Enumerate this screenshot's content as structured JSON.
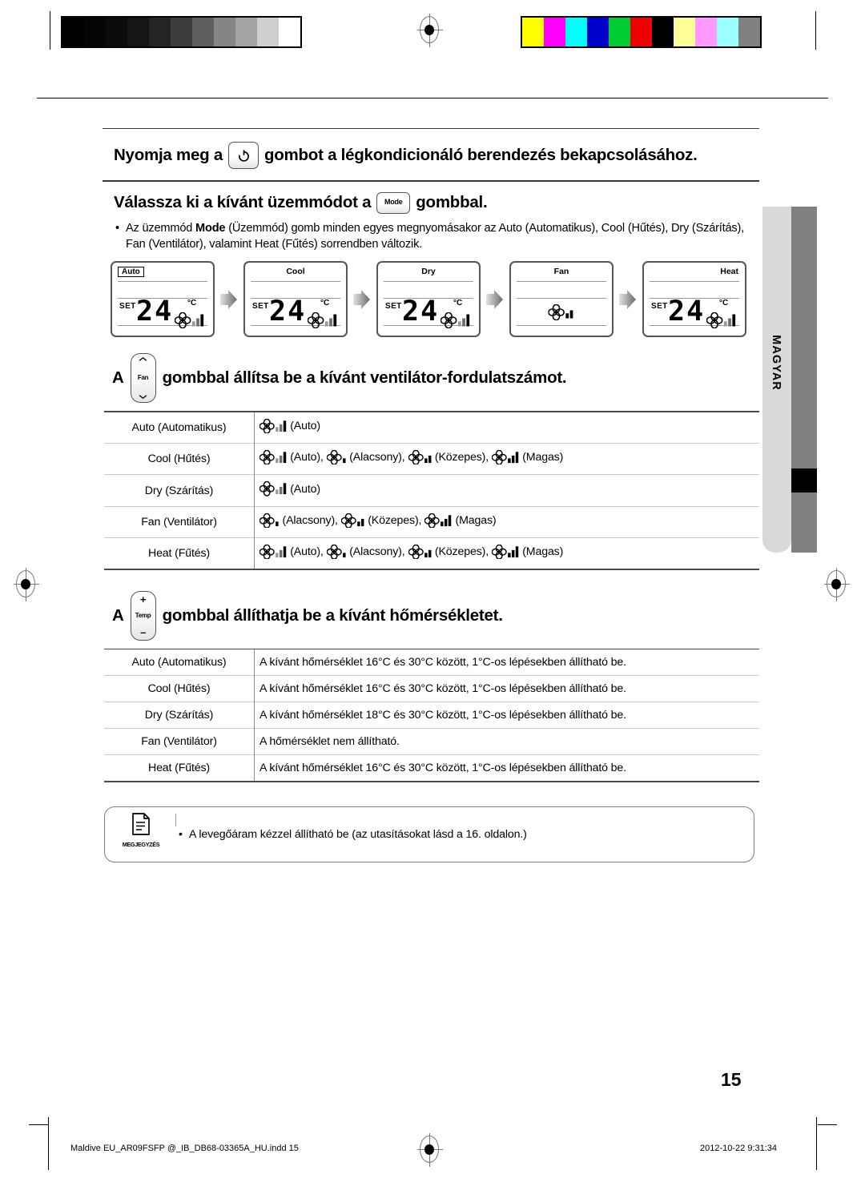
{
  "language_tab": {
    "label": "MAGYAR"
  },
  "section_power": {
    "text_before": "Nyomja meg a",
    "button_icon": "power-icon",
    "text_after": "gombot a légkondicionáló berendezés bekapcsolásához."
  },
  "section_mode": {
    "text_before": "Válassza ki a kívánt üzemmódot a",
    "button_label": "Mode",
    "text_after": "gombbal.",
    "bullet": {
      "part1": "Az üzemmód ",
      "bold": "Mode",
      "part2": " (Üzemmód) gomb minden egyes megnyomásakor az Auto (Automatikus), Cool (Hűtés), Dry (Szárítás), Fan (Ventilátor), valamint Heat (Fűtés) sorrendben változik."
    },
    "displays": [
      {
        "mode": "Auto",
        "label_style": "boxed",
        "set_label": "SET",
        "temperature": "24",
        "unit": "°C",
        "fan_bars": "auto",
        "has_temp": true
      },
      {
        "mode": "Cool",
        "label_style": "center",
        "set_label": "SET",
        "temperature": "24",
        "unit": "°C",
        "fan_bars": "auto",
        "has_temp": true
      },
      {
        "mode": "Dry",
        "label_style": "center",
        "set_label": "SET",
        "temperature": "24",
        "unit": "°C",
        "fan_bars": "auto",
        "has_temp": true
      },
      {
        "mode": "Fan",
        "label_style": "center",
        "set_label": "",
        "temperature": "",
        "unit": "",
        "fan_bars": "medium",
        "has_temp": false
      },
      {
        "mode": "Heat",
        "label_style": "right",
        "set_label": "SET",
        "temperature": "24",
        "unit": "°C",
        "fan_bars": "auto",
        "has_temp": true
      }
    ]
  },
  "section_fan": {
    "text_before": "A",
    "button_label": "Fan",
    "text_after": "gombbal állítsa be a kívánt ventilátor-fordulatszámot.",
    "rows": [
      {
        "mode": "Auto (Automatikus)",
        "speeds": [
          {
            "bars": "auto",
            "label": "(Auto)"
          }
        ]
      },
      {
        "mode": "Cool (Hűtés)",
        "speeds": [
          {
            "bars": "auto",
            "label": "(Auto),"
          },
          {
            "bars": "low",
            "label": "(Alacsony),"
          },
          {
            "bars": "medium",
            "label": "(Közepes),"
          },
          {
            "bars": "high",
            "label": "(Magas)"
          }
        ]
      },
      {
        "mode": "Dry (Szárítás)",
        "speeds": [
          {
            "bars": "auto",
            "label": "(Auto)"
          }
        ]
      },
      {
        "mode": "Fan (Ventilátor)",
        "speeds": [
          {
            "bars": "low",
            "label": "(Alacsony),"
          },
          {
            "bars": "medium",
            "label": "(Közepes),"
          },
          {
            "bars": "high",
            "label": "(Magas)"
          }
        ]
      },
      {
        "mode": "Heat (Fűtés)",
        "speeds": [
          {
            "bars": "auto",
            "label": "(Auto),"
          },
          {
            "bars": "low",
            "label": "(Alacsony),"
          },
          {
            "bars": "medium",
            "label": "(Közepes),"
          },
          {
            "bars": "high",
            "label": "(Magas)"
          }
        ]
      }
    ]
  },
  "section_temp": {
    "text_before": "A",
    "button_label": "Temp",
    "button_plus": "+",
    "button_minus": "–",
    "text_after": "gombbal állíthatja be a kívánt hőmérsékletet.",
    "rows": [
      {
        "mode": "Auto (Automatikus)",
        "desc": "A kívánt hőmérséklet 16°C és 30°C között, 1°C-os lépésekben állítható be."
      },
      {
        "mode": "Cool (Hűtés)",
        "desc": "A kívánt hőmérséklet 16°C és 30°C között, 1°C-os lépésekben állítható be."
      },
      {
        "mode": "Dry (Szárítás)",
        "desc": "A kívánt hőmérséklet 18°C és 30°C között, 1°C-os lépésekben állítható be."
      },
      {
        "mode": "Fan (Ventilátor)",
        "desc": "A hőmérséklet nem állítható."
      },
      {
        "mode": "Heat (Fűtés)",
        "desc": "A kívánt hőmérséklet 16°C és 30°C között, 1°C-os lépésekben állítható be."
      }
    ]
  },
  "note": {
    "caption": "MEGJEGYZÉS",
    "icon": "document-icon",
    "text": "A levegőáram kézzel állítható be (az utasításokat lásd a 16. oldalon.)"
  },
  "page_number": "15",
  "footer": {
    "left": "Maldive EU_AR09FSFP @_IB_DB68-03365A_HU.indd   15",
    "right": "2012-10-22   9:31:34"
  },
  "calibration": {
    "grayscale": [
      "#000000",
      "#050505",
      "#0b0b0b",
      "#151515",
      "#242424",
      "#3d3d3d",
      "#5e5e5e",
      "#858585",
      "#a5a5a5",
      "#cfcfcf",
      "#ffffff"
    ],
    "colors": [
      "#ffff00",
      "#ff00ff",
      "#00ffff",
      "#0000cc",
      "#00cc33",
      "#ee0000",
      "#000000",
      "#ffff99",
      "#ff99ff",
      "#99ffff",
      "#808080"
    ]
  }
}
